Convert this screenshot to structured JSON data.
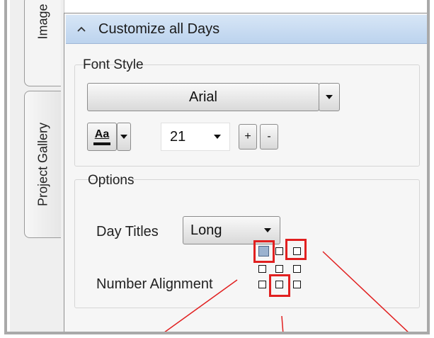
{
  "tabs": {
    "image_label": "Image (",
    "gallery_label": "Project Gallery"
  },
  "panel": {
    "header_title": "Customize all Days",
    "font_style": {
      "title": "Font Style",
      "font_name": "Arial",
      "font_size": "21",
      "text_button": "Aa",
      "plus": "+",
      "minus": "-"
    },
    "options": {
      "title": "Options",
      "day_titles_label": "Day Titles",
      "day_titles_value": "Long",
      "number_alignment_label": "Number Alignment"
    }
  },
  "colors": {
    "header_bg": "#c8dbf2",
    "highlight": "#e12020",
    "selected_cell": "#9bb2cf"
  },
  "alignment_grid": {
    "selected": "top-left",
    "highlighted": [
      "top-left",
      "top-right",
      "bottom-center"
    ]
  }
}
